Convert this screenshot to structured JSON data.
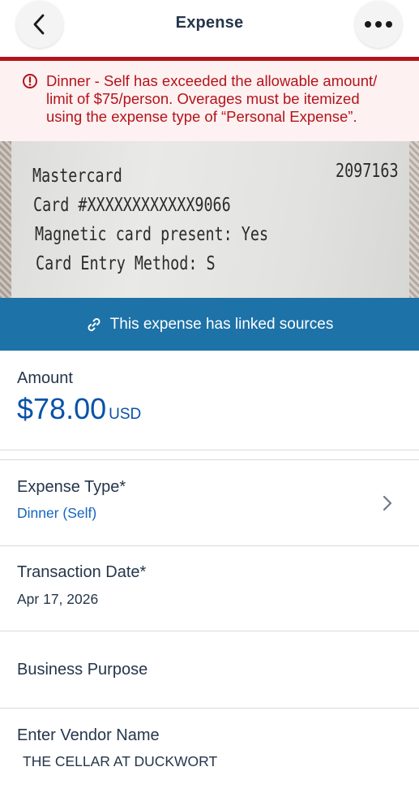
{
  "header": {
    "title": "Expense",
    "back_icon": "chevron-left-icon",
    "more_icon": "more-horizontal-icon"
  },
  "alert": {
    "icon": "alert-circle-icon",
    "color": "#b3141b",
    "lines": [
      "Dinner - Self has exceeded the allowable amount/",
      "limit of $75/person. Overages must be itemized",
      "using the expense type of “Personal Expense”."
    ]
  },
  "receipt": {
    "lines": [
      "Mastercard",
      "Card #XXXXXXXXXXXX9066",
      "Magnetic card present: Yes",
      "Card Entry Method:  S"
    ],
    "number": "2097163"
  },
  "linked_sources": {
    "label": "This expense has linked sources",
    "icon": "link-icon",
    "color": "#1d72a8"
  },
  "amount": {
    "label": "Amount",
    "value": "$78.00",
    "currency": "USD"
  },
  "expense_type": {
    "label": "Expense Type*",
    "value": "Dinner (Self)"
  },
  "transaction_date": {
    "label": "Transaction Date*",
    "value": "Apr 17, 2026"
  },
  "business_purpose": {
    "label": "Business Purpose"
  },
  "vendor": {
    "label": "Enter Vendor Name",
    "value": "THE CELLAR AT DUCKWORT"
  }
}
